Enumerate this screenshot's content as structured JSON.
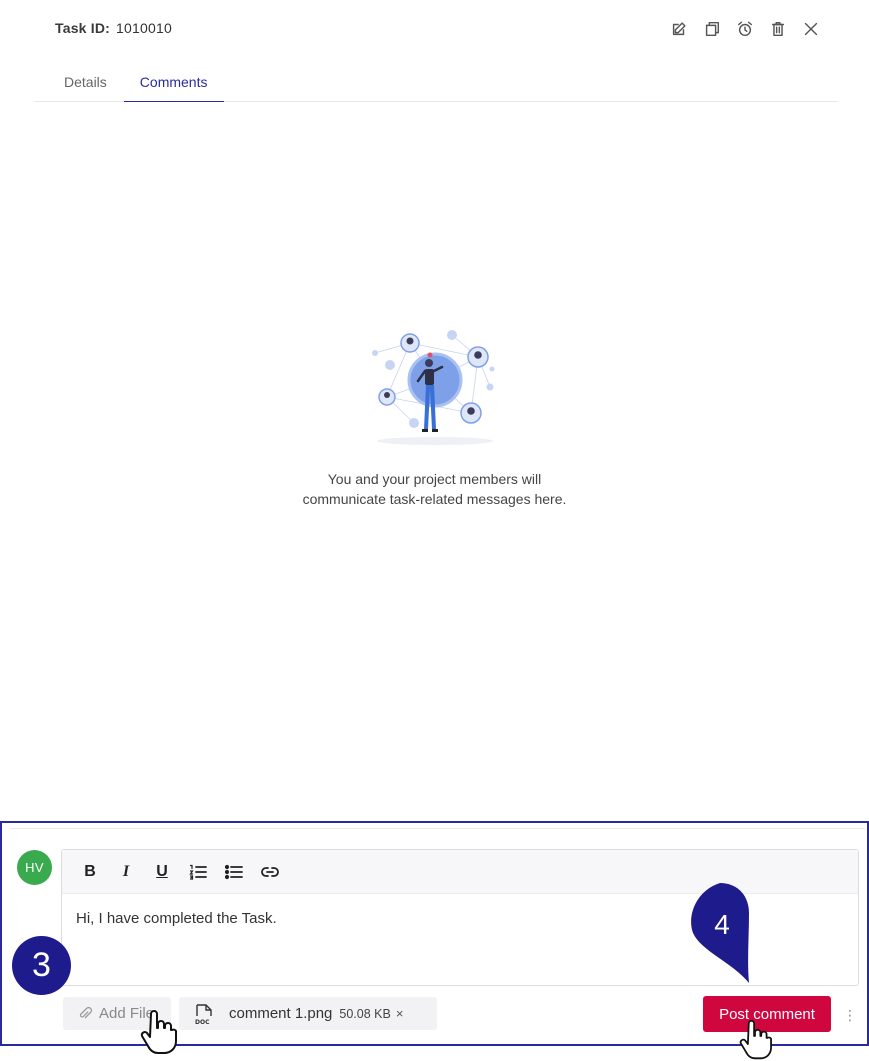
{
  "header": {
    "task_id_label": "Task ID:",
    "task_id_value": "1010010",
    "actions": [
      "edit-icon",
      "copy-icon",
      "alarm-icon",
      "delete-icon",
      "close-icon"
    ]
  },
  "tabs": [
    {
      "label": "Details",
      "active": false
    },
    {
      "label": "Comments",
      "active": true
    }
  ],
  "empty_state": {
    "line1": "You and your project members will",
    "line2": "communicate task-related messages here."
  },
  "composer": {
    "avatar_initials": "HV",
    "avatar_color": "#3aaa4e",
    "toolbar": {
      "bold": "B",
      "italic": "I",
      "underline": "U",
      "ordered_list": "ordered-list-icon",
      "bullet_list": "bullet-list-icon",
      "link": "link-icon"
    },
    "text": "Hi, I have completed the Task.",
    "add_file_label": "Add File",
    "attachment": {
      "name": "comment 1.png",
      "size": "50.08 KB",
      "remove": "×"
    },
    "post_label": "Post comment",
    "more": "⋮",
    "accent_color": "#d0063f"
  },
  "annotations": {
    "step3": "3",
    "step4": "4",
    "color": "#1e1b8c"
  }
}
